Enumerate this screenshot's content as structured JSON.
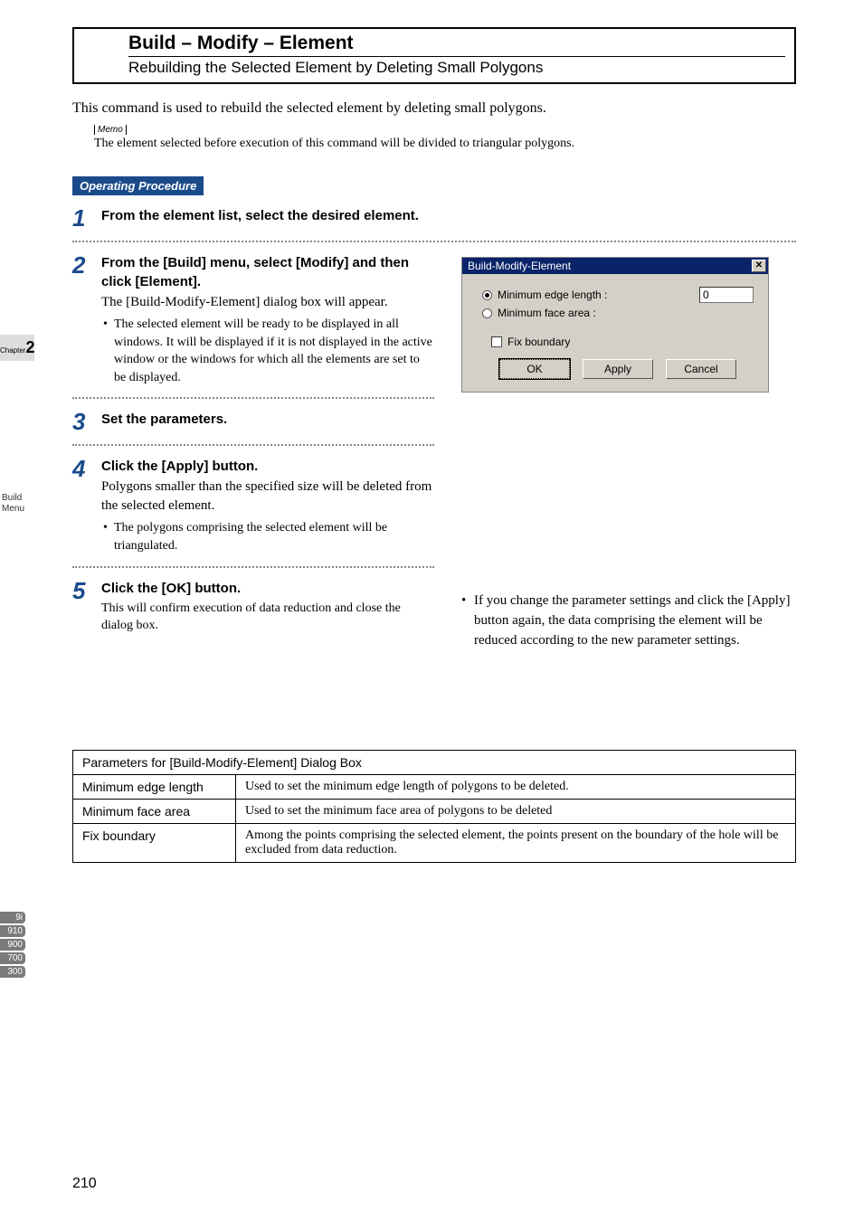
{
  "header": {
    "title": "Build – Modify – Element",
    "subtitle": "Rebuilding the Selected Element by Deleting Small Polygons"
  },
  "intro": "This command is used to rebuild the selected element by deleting small polygons.",
  "memo": {
    "tag": "Memo",
    "text": "The element selected before execution of this command will be divided to triangular polygons."
  },
  "op_label": "Operating Procedure",
  "steps": {
    "s1": {
      "num": "1",
      "title": "From the element list, select  the desired element."
    },
    "s2": {
      "num": "2",
      "title": "From the [Build] menu, select [Modify] and then click [Element].",
      "desc": "The [Build-Modify-Element] dialog box will appear.",
      "bullet": "The selected element will be ready to be displayed in all windows. It will be displayed if it is not displayed in the active window or the windows for which all the elements are set to be displayed."
    },
    "s3": {
      "num": "3",
      "title": "Set the parameters."
    },
    "s4": {
      "num": "4",
      "title": "Click the [Apply] button.",
      "desc": "Polygons smaller than the specified size will be deleted from the selected element.",
      "bullet": "The polygons comprising the selected element will be triangulated."
    },
    "s5": {
      "num": "5",
      "title": "Click the [OK] button.",
      "desc": "This will confirm execution of data reduction and close the dialog box."
    }
  },
  "side_note": "If you change the parameter settings and click the [Apply] button again, the data comprising the element will be reduced according to the new parameter settings.",
  "dialog": {
    "title": "Build-Modify-Element",
    "opt1": "Minimum edge length  :",
    "opt2": "Minimum face area     :",
    "value": "0",
    "fix": "Fix boundary",
    "ok": "OK",
    "apply": "Apply",
    "cancel": "Cancel"
  },
  "table": {
    "header": "Parameters for [Build-Modify-Element] Dialog Box",
    "rows": [
      {
        "name": "Minimum edge length",
        "desc": "Used to set the minimum edge length of polygons to be deleted."
      },
      {
        "name": "Minimum face area",
        "desc": "Used to set the minimum face area of polygons to be deleted"
      },
      {
        "name": "Fix boundary",
        "desc": "Among the points comprising the selected element, the points present on the boundary of the hole will be excluded from data reduction."
      }
    ]
  },
  "sidebar": {
    "chapter_label": "Chapter",
    "chapter_num": "2",
    "build": "Build",
    "menu": "Menu",
    "tags": [
      "9i",
      "910",
      "900",
      "700",
      "300"
    ]
  },
  "page_num": "210"
}
